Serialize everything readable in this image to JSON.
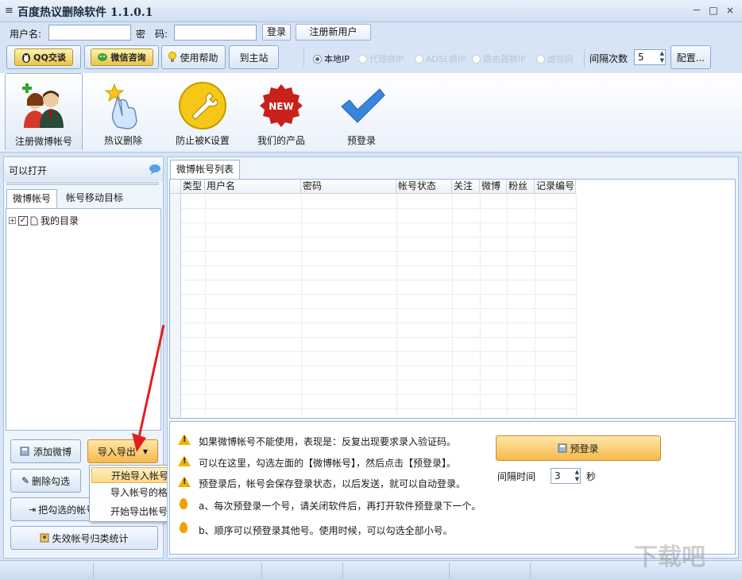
{
  "window": {
    "title": "百度热议删除软件 1.1.0.1",
    "controls": [
      "－",
      "□",
      "×"
    ]
  },
  "login": {
    "username_label": "用户名:",
    "password_label": "密　码:",
    "username_value": "",
    "password_value": "",
    "login_button": "登录",
    "register_button": "注册新用户"
  },
  "toolbar": {
    "qq_button": "QQ交谈",
    "wechat_button": "微信咨询",
    "help_button": "使用帮助",
    "home_button": "到主站",
    "ip_options": [
      {
        "label": "本地IP",
        "selected": true,
        "enabled": true
      },
      {
        "label": "代理换IP",
        "selected": false,
        "enabled": false
      },
      {
        "label": "ADSL换IP",
        "selected": false,
        "enabled": false
      },
      {
        "label": "路由器换IP",
        "selected": false,
        "enabled": false
      },
      {
        "label": "虚拟网",
        "selected": false,
        "enabled": false
      }
    ],
    "interval_label": "间隔次数",
    "interval_value": "5",
    "config_button": "配置..."
  },
  "ribbon": {
    "items": [
      {
        "label": "注册微博帐号",
        "icon": "users-icon",
        "selected": true
      },
      {
        "label": "热议删除",
        "icon": "hand-pointer-icon",
        "selected": false
      },
      {
        "label": "防止被K设置",
        "icon": "wrench-icon",
        "selected": false
      },
      {
        "label": "我们的产品",
        "icon": "new-badge-icon",
        "selected": false
      },
      {
        "label": "预登录",
        "icon": "checkmark-icon",
        "selected": false
      }
    ]
  },
  "left": {
    "header": "可以打开",
    "tabs": [
      "微博帐号",
      "帐号移动目标"
    ],
    "tree_root": "我的目录",
    "buttons": {
      "add": "添加微博",
      "import_export": "导入导出",
      "delete_checked": "删除勾选",
      "move_checked": "把勾选的帐号批",
      "stats": "失效帐号归类统计"
    },
    "menu": [
      "开始导入帐号",
      "导入帐号的格式...",
      "开始导出帐号"
    ]
  },
  "right": {
    "tab": "微博帐号列表",
    "columns": [
      "类型",
      "用户名",
      "密码",
      "帐号状态",
      "关注",
      "微博",
      "粉丝",
      "记录编号"
    ],
    "tips": [
      "如果微博帐号不能使用，表现是：反复出现要求录入验证码。",
      "可以在这里，勾选左面的【微博帐号】，然后点击【预登录】。",
      "预登录后，帐号会保存登录状态，以后发送，就可以自动登录。",
      "a、每次预登录一个号，请关闭软件后，再打开软件预登录下一个。",
      "b、顺序可以预登录其他号。使用时候，可以勾选全部小号。"
    ],
    "prelogin_button": "预登录",
    "interval_label": "间隔时间",
    "interval_value": "3",
    "interval_unit": "秒"
  },
  "watermark": "下载吧",
  "colors": {
    "accent": "#3c6db0",
    "orange": "#f5b94d",
    "arrow": "#e02020"
  }
}
